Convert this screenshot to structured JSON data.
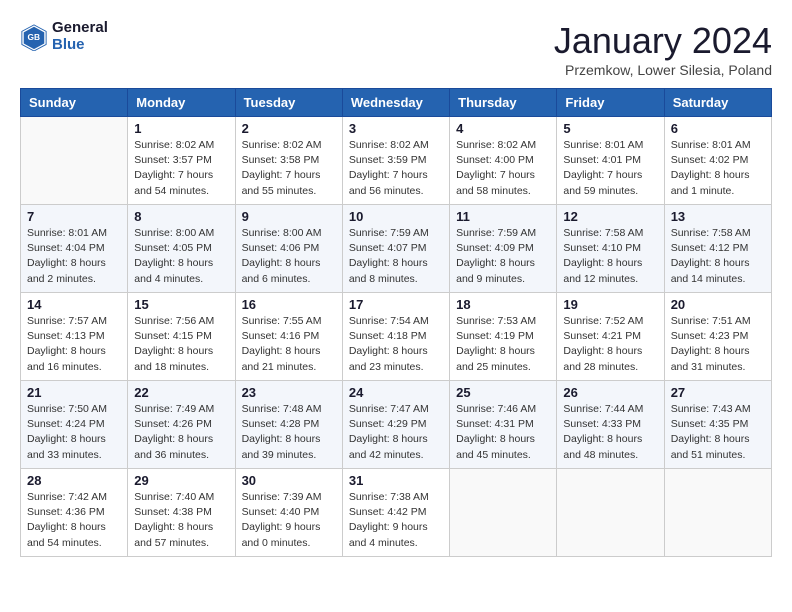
{
  "logo": {
    "line1": "General",
    "line2": "Blue"
  },
  "title": "January 2024",
  "location": "Przemkow, Lower Silesia, Poland",
  "weekdays": [
    "Sunday",
    "Monday",
    "Tuesday",
    "Wednesday",
    "Thursday",
    "Friday",
    "Saturday"
  ],
  "weeks": [
    [
      {
        "day": "",
        "sunrise": "",
        "sunset": "",
        "daylight": ""
      },
      {
        "day": "1",
        "sunrise": "Sunrise: 8:02 AM",
        "sunset": "Sunset: 3:57 PM",
        "daylight": "Daylight: 7 hours and 54 minutes."
      },
      {
        "day": "2",
        "sunrise": "Sunrise: 8:02 AM",
        "sunset": "Sunset: 3:58 PM",
        "daylight": "Daylight: 7 hours and 55 minutes."
      },
      {
        "day": "3",
        "sunrise": "Sunrise: 8:02 AM",
        "sunset": "Sunset: 3:59 PM",
        "daylight": "Daylight: 7 hours and 56 minutes."
      },
      {
        "day": "4",
        "sunrise": "Sunrise: 8:02 AM",
        "sunset": "Sunset: 4:00 PM",
        "daylight": "Daylight: 7 hours and 58 minutes."
      },
      {
        "day": "5",
        "sunrise": "Sunrise: 8:01 AM",
        "sunset": "Sunset: 4:01 PM",
        "daylight": "Daylight: 7 hours and 59 minutes."
      },
      {
        "day": "6",
        "sunrise": "Sunrise: 8:01 AM",
        "sunset": "Sunset: 4:02 PM",
        "daylight": "Daylight: 8 hours and 1 minute."
      }
    ],
    [
      {
        "day": "7",
        "sunrise": "Sunrise: 8:01 AM",
        "sunset": "Sunset: 4:04 PM",
        "daylight": "Daylight: 8 hours and 2 minutes."
      },
      {
        "day": "8",
        "sunrise": "Sunrise: 8:00 AM",
        "sunset": "Sunset: 4:05 PM",
        "daylight": "Daylight: 8 hours and 4 minutes."
      },
      {
        "day": "9",
        "sunrise": "Sunrise: 8:00 AM",
        "sunset": "Sunset: 4:06 PM",
        "daylight": "Daylight: 8 hours and 6 minutes."
      },
      {
        "day": "10",
        "sunrise": "Sunrise: 7:59 AM",
        "sunset": "Sunset: 4:07 PM",
        "daylight": "Daylight: 8 hours and 8 minutes."
      },
      {
        "day": "11",
        "sunrise": "Sunrise: 7:59 AM",
        "sunset": "Sunset: 4:09 PM",
        "daylight": "Daylight: 8 hours and 9 minutes."
      },
      {
        "day": "12",
        "sunrise": "Sunrise: 7:58 AM",
        "sunset": "Sunset: 4:10 PM",
        "daylight": "Daylight: 8 hours and 12 minutes."
      },
      {
        "day": "13",
        "sunrise": "Sunrise: 7:58 AM",
        "sunset": "Sunset: 4:12 PM",
        "daylight": "Daylight: 8 hours and 14 minutes."
      }
    ],
    [
      {
        "day": "14",
        "sunrise": "Sunrise: 7:57 AM",
        "sunset": "Sunset: 4:13 PM",
        "daylight": "Daylight: 8 hours and 16 minutes."
      },
      {
        "day": "15",
        "sunrise": "Sunrise: 7:56 AM",
        "sunset": "Sunset: 4:15 PM",
        "daylight": "Daylight: 8 hours and 18 minutes."
      },
      {
        "day": "16",
        "sunrise": "Sunrise: 7:55 AM",
        "sunset": "Sunset: 4:16 PM",
        "daylight": "Daylight: 8 hours and 21 minutes."
      },
      {
        "day": "17",
        "sunrise": "Sunrise: 7:54 AM",
        "sunset": "Sunset: 4:18 PM",
        "daylight": "Daylight: 8 hours and 23 minutes."
      },
      {
        "day": "18",
        "sunrise": "Sunrise: 7:53 AM",
        "sunset": "Sunset: 4:19 PM",
        "daylight": "Daylight: 8 hours and 25 minutes."
      },
      {
        "day": "19",
        "sunrise": "Sunrise: 7:52 AM",
        "sunset": "Sunset: 4:21 PM",
        "daylight": "Daylight: 8 hours and 28 minutes."
      },
      {
        "day": "20",
        "sunrise": "Sunrise: 7:51 AM",
        "sunset": "Sunset: 4:23 PM",
        "daylight": "Daylight: 8 hours and 31 minutes."
      }
    ],
    [
      {
        "day": "21",
        "sunrise": "Sunrise: 7:50 AM",
        "sunset": "Sunset: 4:24 PM",
        "daylight": "Daylight: 8 hours and 33 minutes."
      },
      {
        "day": "22",
        "sunrise": "Sunrise: 7:49 AM",
        "sunset": "Sunset: 4:26 PM",
        "daylight": "Daylight: 8 hours and 36 minutes."
      },
      {
        "day": "23",
        "sunrise": "Sunrise: 7:48 AM",
        "sunset": "Sunset: 4:28 PM",
        "daylight": "Daylight: 8 hours and 39 minutes."
      },
      {
        "day": "24",
        "sunrise": "Sunrise: 7:47 AM",
        "sunset": "Sunset: 4:29 PM",
        "daylight": "Daylight: 8 hours and 42 minutes."
      },
      {
        "day": "25",
        "sunrise": "Sunrise: 7:46 AM",
        "sunset": "Sunset: 4:31 PM",
        "daylight": "Daylight: 8 hours and 45 minutes."
      },
      {
        "day": "26",
        "sunrise": "Sunrise: 7:44 AM",
        "sunset": "Sunset: 4:33 PM",
        "daylight": "Daylight: 8 hours and 48 minutes."
      },
      {
        "day": "27",
        "sunrise": "Sunrise: 7:43 AM",
        "sunset": "Sunset: 4:35 PM",
        "daylight": "Daylight: 8 hours and 51 minutes."
      }
    ],
    [
      {
        "day": "28",
        "sunrise": "Sunrise: 7:42 AM",
        "sunset": "Sunset: 4:36 PM",
        "daylight": "Daylight: 8 hours and 54 minutes."
      },
      {
        "day": "29",
        "sunrise": "Sunrise: 7:40 AM",
        "sunset": "Sunset: 4:38 PM",
        "daylight": "Daylight: 8 hours and 57 minutes."
      },
      {
        "day": "30",
        "sunrise": "Sunrise: 7:39 AM",
        "sunset": "Sunset: 4:40 PM",
        "daylight": "Daylight: 9 hours and 0 minutes."
      },
      {
        "day": "31",
        "sunrise": "Sunrise: 7:38 AM",
        "sunset": "Sunset: 4:42 PM",
        "daylight": "Daylight: 9 hours and 4 minutes."
      },
      {
        "day": "",
        "sunrise": "",
        "sunset": "",
        "daylight": ""
      },
      {
        "day": "",
        "sunrise": "",
        "sunset": "",
        "daylight": ""
      },
      {
        "day": "",
        "sunrise": "",
        "sunset": "",
        "daylight": ""
      }
    ]
  ]
}
